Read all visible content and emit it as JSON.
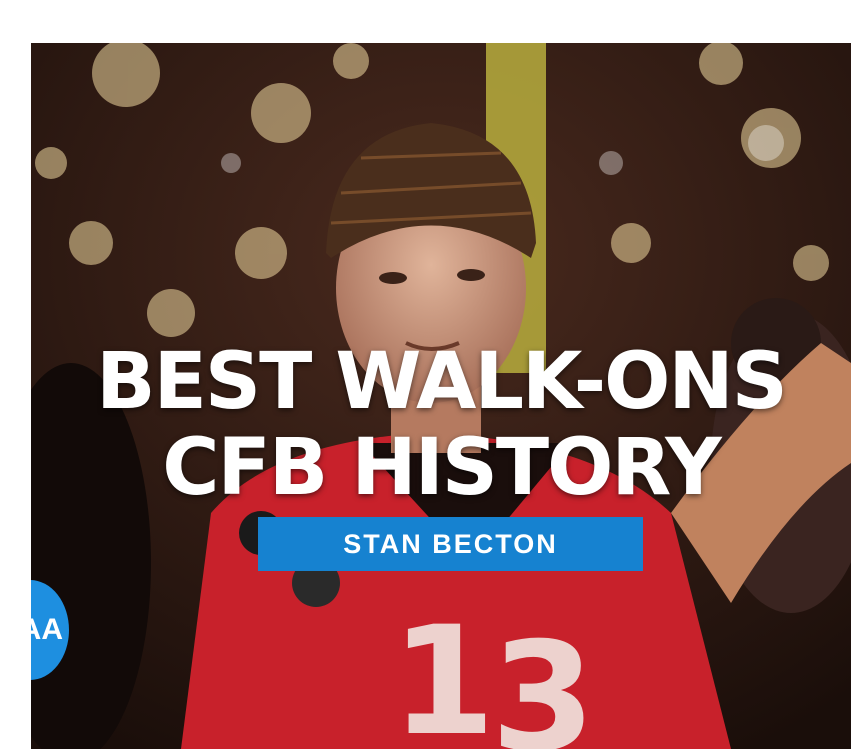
{
  "article_card": {
    "headline_line1": "BEST WALK-ONS",
    "headline_line2": "CFB HISTORY",
    "byline": "STAN BECTON",
    "logo_text": "AA"
  },
  "colors": {
    "byline_background": "#1682d0",
    "jersey_red": "#c8212b",
    "goalpost_yellow": "#c9c04a"
  },
  "icons": {
    "logo": "ncaa-logo-icon"
  }
}
